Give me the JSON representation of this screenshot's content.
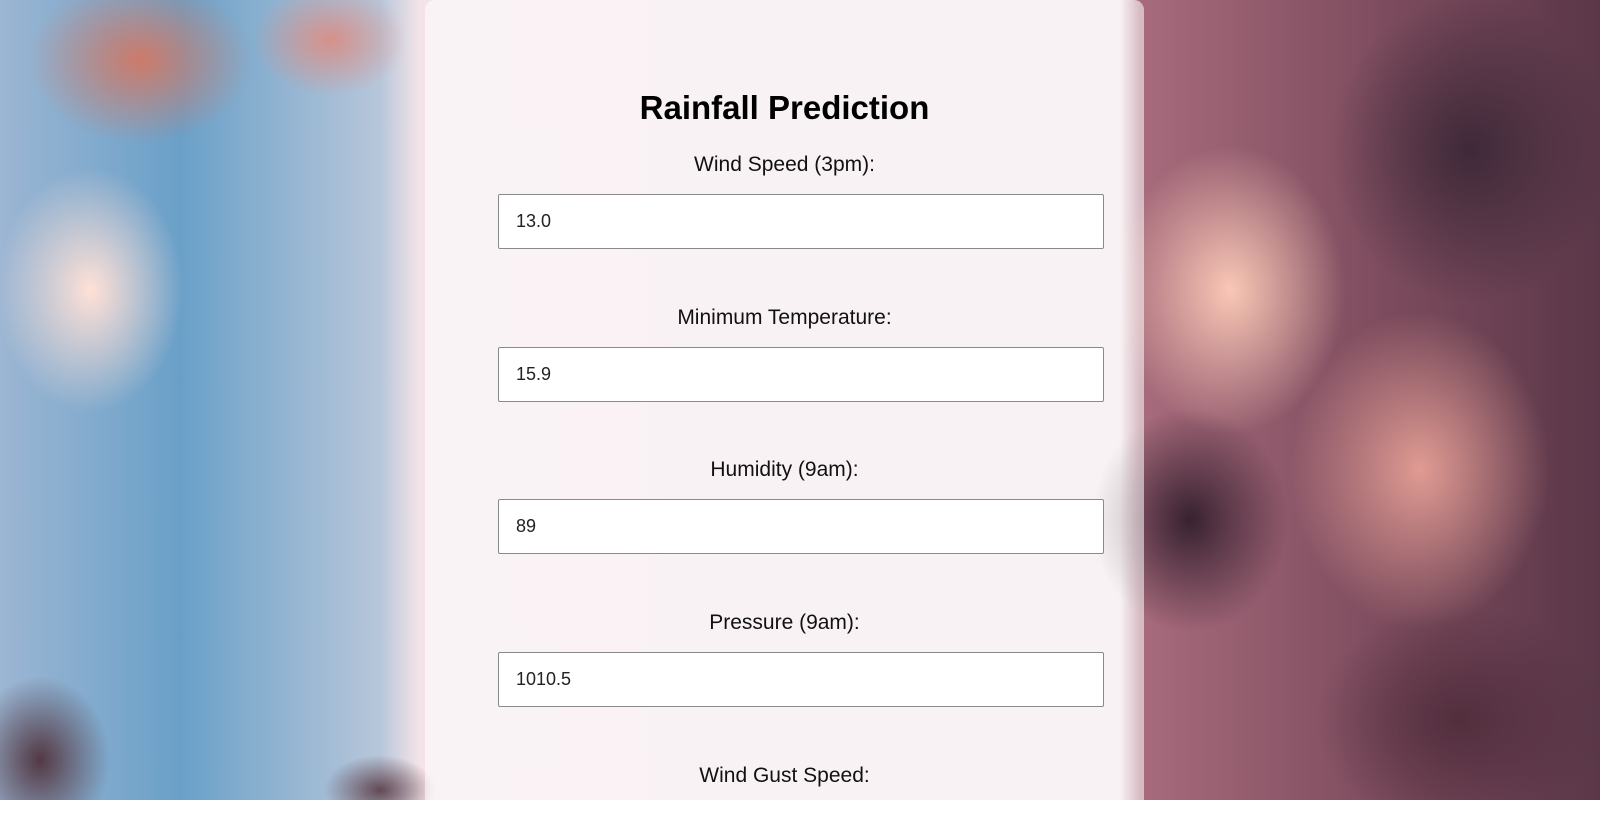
{
  "form": {
    "title": "Rainfall Prediction",
    "fields": [
      {
        "label": "Wind Speed (3pm):",
        "value": "13.0"
      },
      {
        "label": "Minimum Temperature:",
        "value": "15.9"
      },
      {
        "label": "Humidity (9am):",
        "value": "89"
      },
      {
        "label": "Pressure (9am):",
        "value": "1010.5"
      },
      {
        "label": "Wind Gust Speed:",
        "value": ""
      }
    ]
  }
}
